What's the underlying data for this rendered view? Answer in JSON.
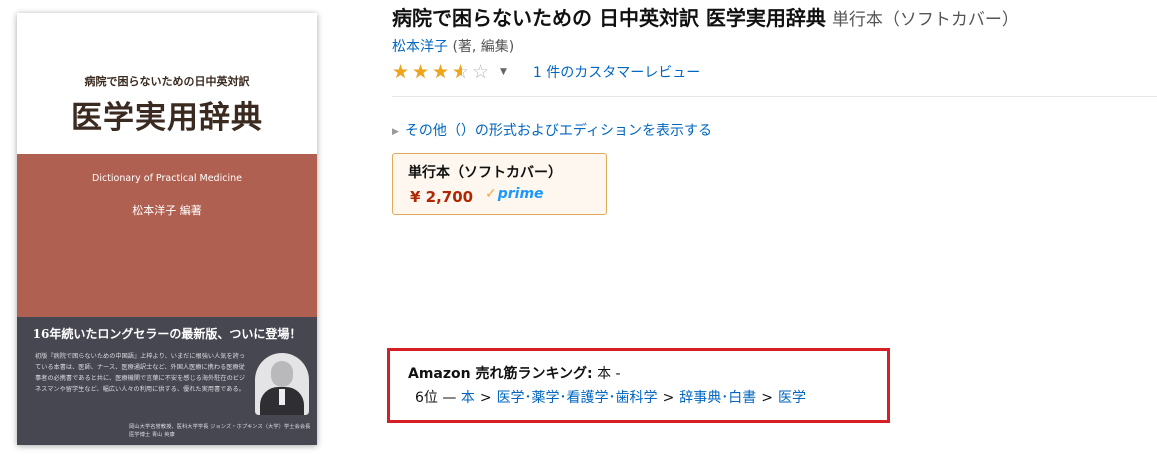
{
  "cover": {
    "subtitle": "病院で困らないための日中英対訳",
    "title": "医学実用辞典",
    "english_title": "Dictionary of Practical Medicine",
    "author": "松本洋子 編著",
    "headline": "16年続いたロングセラーの最新版、ついに登場！",
    "blurb": "初版『病院で困らないための中国語』上梓より、いまだに根強い人気を誇っている本書は、医師、ナース、医療通訳士など、外国人医療に携わる医療従事者の必携書であると共に、医療機関で言葉に不安を感じる海外駐在のビジネスマンや留学生など、幅広い人々の利用に供する、優れた実用書である。",
    "credit": "岡山大学名誉教授、医科大学学長 ジョンズ・ホプキンス（大学）学士会会長 医学博士 青山 英康"
  },
  "product": {
    "title": "病院で困らないための 日中英対訳 医学実用辞典",
    "binding": "単行本（ソフトカバー）",
    "author": "松本洋子",
    "role": " (著, 編集)",
    "rating": 3.5,
    "rating_max": 5,
    "dropdown_icon": "caret-down-icon",
    "reviews_link": "1 件のカスタマーレビュー",
    "other_formats": "その他（）の形式およびエディションを表示する"
  },
  "format_box": {
    "name": "単行本（ソフトカバー）",
    "price": "¥ 2,700",
    "prime_label": "prime"
  },
  "ranking": {
    "label": "Amazon 売れ筋ランキング:",
    "category": " 本 -",
    "rank": "6位",
    "dash": " — ",
    "crumbs": [
      "本",
      "医学･薬学･看護学･歯科学",
      "辞事典･白書",
      "医学"
    ]
  },
  "colors": {
    "link": "#0066c0",
    "price": "#b12704",
    "star": "#f0a519",
    "highlight_border": "#d51e25",
    "format_border": "#e3a95b"
  }
}
